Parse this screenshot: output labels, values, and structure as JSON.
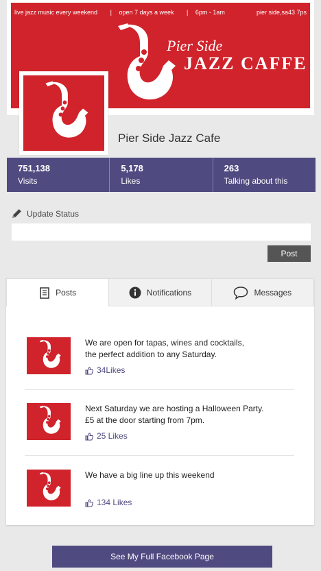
{
  "cover": {
    "info_left": [
      "live jazz music every weekend",
      "open 7 days a week",
      "6pm - 1am"
    ],
    "separator": "|",
    "info_right": "pier side,sa43 7ps",
    "brand_line1": "Pier Side",
    "brand_line2": "JAZZ CAFFE",
    "brand_color": "#d0232b"
  },
  "page": {
    "name": "Pier Side Jazz Cafe"
  },
  "stats": [
    {
      "value": "751,138",
      "label": "Visits"
    },
    {
      "value": "5,178",
      "label": "Likes"
    },
    {
      "value": "263",
      "label": "Talking about this"
    }
  ],
  "status": {
    "label": "Update Status",
    "value": "",
    "post_label": "Post"
  },
  "tabs": [
    {
      "label": "Posts",
      "icon": "document-icon"
    },
    {
      "label": "Notifications",
      "icon": "info-icon"
    },
    {
      "label": "Messages",
      "icon": "chat-bubble-icon"
    }
  ],
  "posts": [
    {
      "line1": "We are open for tapas, wines and cocktails,",
      "line2": "the perfect addition to any Saturday.",
      "likes": "34Likes"
    },
    {
      "line1": "Next Saturday we are hosting a Halloween Party.",
      "line2": "£5 at the door starting from 7pm.",
      "likes": "25 Likes"
    },
    {
      "line1": "We have a big line up this weekend",
      "line2": "",
      "likes": "134 Likes"
    }
  ],
  "footer": {
    "button_label": "See My Full Facebook Page"
  },
  "colors": {
    "accent": "#4f4a80",
    "brand_red": "#d0232b"
  }
}
